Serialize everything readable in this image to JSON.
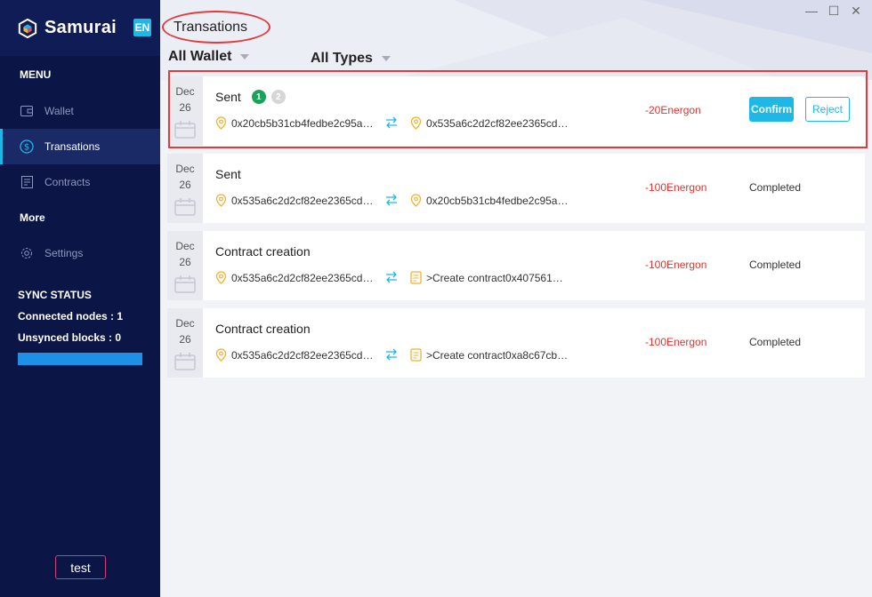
{
  "app": {
    "name": "Samurai",
    "lang": "EN"
  },
  "window": {
    "minimize": "—",
    "maximize": "☐",
    "close": "✕"
  },
  "sidebar": {
    "menu_title": "MENU",
    "items": [
      {
        "label": "Wallet",
        "icon": "wallet-icon",
        "active": false
      },
      {
        "label": "Transations",
        "icon": "dollar-icon",
        "active": true
      },
      {
        "label": "Contracts",
        "icon": "contract-icon",
        "active": false
      }
    ],
    "more_title": "More",
    "settings_label": "Settings",
    "sync": {
      "title": "SYNC STATUS",
      "connected_label": "Connected nodes :",
      "connected_value": "1",
      "unsynced_label": "Unsynced blocks :",
      "unsynced_value": "0",
      "progress": 1.0
    },
    "test_label": "test"
  },
  "page": {
    "title": "Transations",
    "filters": {
      "wallet": "All Wallet",
      "types": "All Types"
    }
  },
  "transactions": [
    {
      "month": "Dec",
      "day": "26",
      "type": "Sent",
      "steps": [
        "1",
        "2"
      ],
      "from": "0x20cb5b31cb4fedbe2c95a…",
      "to": "0x535a6c2d2cf82ee2365cd…",
      "amount": "-20Energon",
      "confirm": "Confirm",
      "reject": "Reject"
    },
    {
      "month": "Dec",
      "day": "26",
      "type": "Sent",
      "from": "0x535a6c2d2cf82ee2365cd…",
      "to": "0x20cb5b31cb4fedbe2c95a…",
      "amount": "-100Energon",
      "status": "Completed"
    },
    {
      "month": "Dec",
      "day": "26",
      "type": "Contract creation",
      "from": "0x535a6c2d2cf82ee2365cd…",
      "to": ">Create contract0x407561…",
      "amount": "-100Energon",
      "status": "Completed"
    },
    {
      "month": "Dec",
      "day": "26",
      "type": "Contract creation",
      "from": "0x535a6c2d2cf82ee2365cd…",
      "to": ">Create contract0xa8c67cb…",
      "amount": "-100Energon",
      "status": "Completed"
    }
  ],
  "colors": {
    "sidebar": "#0c1646",
    "accent": "#1eb7e6",
    "negative": "#e3322f",
    "success": "#1aa15b",
    "highlight": "#e23b3b"
  }
}
